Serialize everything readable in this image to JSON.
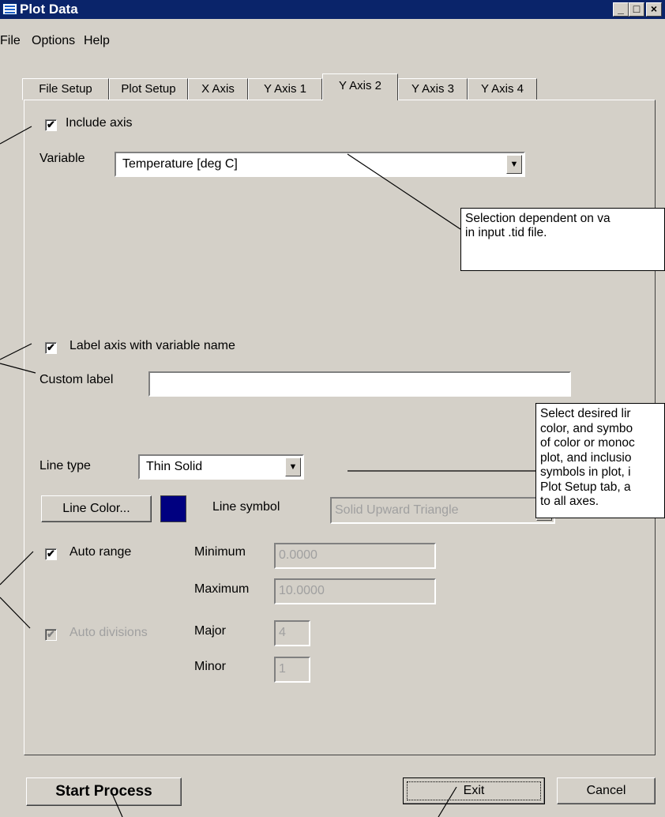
{
  "window": {
    "title": "Plot Data",
    "minimize": "_",
    "maximize": "□",
    "close": "×"
  },
  "menu": [
    "File",
    "Options",
    "Help"
  ],
  "tabs": [
    "File Setup",
    "Plot Setup",
    "X Axis",
    "Y Axis 1",
    "Y Axis 2",
    "Y Axis 3",
    "Y Axis 4"
  ],
  "selected_tab": "Y Axis 2",
  "include_axis": {
    "label": "Include axis",
    "checked": true
  },
  "variable": {
    "label": "Variable",
    "value": "Temperature [deg C]"
  },
  "label_axis": {
    "label": "Label axis with variable name",
    "checked": true
  },
  "custom_label": {
    "label": "Custom label",
    "value": ""
  },
  "line_type": {
    "label": "Line type",
    "value": "Thin Solid"
  },
  "line_color": {
    "button": "Line Color...",
    "color": "#000080"
  },
  "line_symbol": {
    "label": "Line symbol",
    "value": "Solid Upward Triangle"
  },
  "auto_range": {
    "label": "Auto range",
    "checked": true,
    "min_label": "Minimum",
    "min_value": "0.0000",
    "max_label": "Maximum",
    "max_value": "10.0000"
  },
  "auto_divisions": {
    "label": "Auto divisions",
    "checked": true,
    "disabled": true,
    "major_label": "Major",
    "major_value": "4",
    "minor_label": "Minor",
    "minor_value": "1"
  },
  "buttons": {
    "start": "Start Process",
    "exit": "Exit",
    "cancel": "Cancel"
  },
  "callouts": {
    "variable_note": [
      "Selection dependent on va",
      "in input .tid file."
    ],
    "line_note": [
      "Select desired lir",
      "color, and symbo",
      "of color or monoc",
      "plot, and inclusio",
      "symbols in plot, i",
      "Plot Setup tab, a",
      "to all axes."
    ]
  }
}
